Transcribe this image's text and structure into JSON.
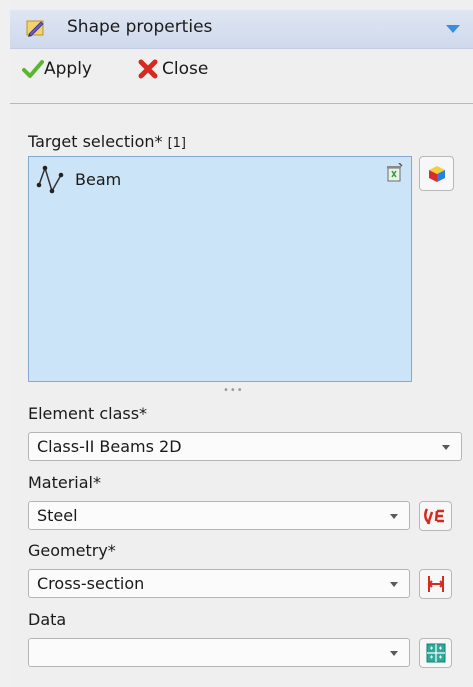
{
  "header": {
    "title": "Shape properties",
    "icon": "pencil-icon",
    "accent": "#3a8ee0"
  },
  "toolbar": {
    "apply_label": "Apply",
    "close_label": "Close"
  },
  "target": {
    "label": "Target selection*",
    "count": "[1]",
    "items": [
      {
        "label": "Beam",
        "icon": "polyline-icon"
      }
    ],
    "box_color": "#cce4f7"
  },
  "fields": {
    "element_class": {
      "label": "Element class*",
      "value": "Class-II Beams 2D"
    },
    "material": {
      "label": "Material*",
      "value": "Steel"
    },
    "geometry": {
      "label": "Geometry*",
      "value": "Cross-section"
    },
    "data": {
      "label": "Data",
      "value": ""
    }
  }
}
